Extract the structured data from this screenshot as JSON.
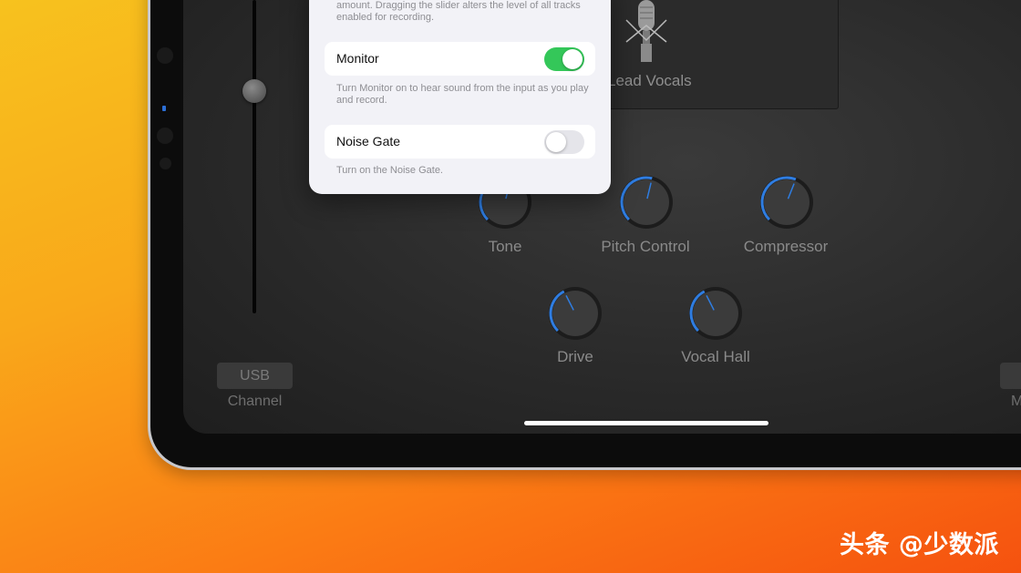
{
  "channel": {
    "usb_label": "USB",
    "channel_label": "Channel",
    "right_label": "M"
  },
  "instrument": {
    "name": "Lead Vocals",
    "icon": "microphone-icon"
  },
  "knobs": [
    {
      "label": "Tone",
      "level": 0.55
    },
    {
      "label": "Pitch Control",
      "level": 0.55
    },
    {
      "label": "Compressor",
      "level": 0.58
    },
    {
      "label": "Drive",
      "level": 0.4
    },
    {
      "label": "Vocal Hall",
      "level": 0.4
    }
  ],
  "popover": {
    "intro_text": "amount. Dragging the slider alters the level of all tracks enabled for recording.",
    "monitor": {
      "label": "Monitor",
      "enabled": true,
      "description": "Turn Monitor on to hear sound from the input as you play and record."
    },
    "noise_gate": {
      "label": "Noise Gate",
      "enabled": false,
      "description": "Turn on the Noise Gate."
    }
  },
  "colors": {
    "accent": "#2f7de1",
    "toggle_on": "#34c759"
  },
  "watermark": "头条 @少数派"
}
